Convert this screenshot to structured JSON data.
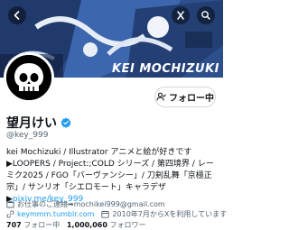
{
  "header": {
    "banner_text": "KEI MOCHIZUKI",
    "banner_color": "#2d4f8c"
  },
  "actions": {
    "follow_label": "フォロー中"
  },
  "profile": {
    "name": "望月けい",
    "handle": "@key_999",
    "verified_color": "#1d9bf0",
    "bio_text": "kei Mochizuki / Illustrator アニメと絵が好きです ▶LOOPERS / Project:;COLD シリーズ / 第四境界 / レーミク2025 / FGO「バーヴァンシー」/ 刀剣乱舞「京極正宗」/ サンリオ「シエロモート」キャラデザ ▶",
    "bio_link": "pixiv.me/key_999",
    "job": "お仕事のご連絡➡mochikei999@gmail.com",
    "website": "keymmm.tumblr.com",
    "joined": "2010年7月からXを利用しています"
  },
  "stats": {
    "following_count": "707",
    "following_label": "フォロー中",
    "followers_count": "1,000,060",
    "followers_label": "フォロワー"
  },
  "colors": {
    "link": "#1d9bf0",
    "muted": "#536471"
  }
}
